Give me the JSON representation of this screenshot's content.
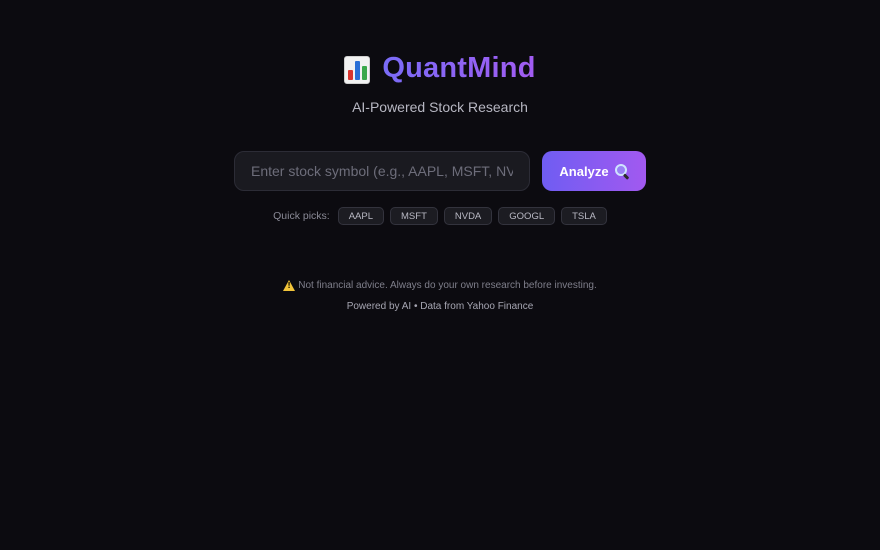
{
  "header": {
    "logo_icon": "bar-chart-icon",
    "title": "QuantMind",
    "subtitle": "AI-Powered Stock Research"
  },
  "search": {
    "value": "",
    "placeholder": "Enter stock symbol (e.g., AAPL, MSFT, NVDA)",
    "button_label": "Analyze",
    "button_icon": "magnifier-icon"
  },
  "quick_picks": {
    "label": "Quick picks:",
    "items": [
      "AAPL",
      "MSFT",
      "NVDA",
      "GOOGL",
      "TSLA"
    ]
  },
  "disclaimer": {
    "icon": "warning-icon",
    "text": "Not financial advice. Always do your own research before investing."
  },
  "footer": {
    "text": "Powered by AI • Data from Yahoo Finance"
  },
  "colors": {
    "background": "#0c0b10",
    "accent_start": "#6f5df2",
    "accent_end": "#a259f0"
  }
}
